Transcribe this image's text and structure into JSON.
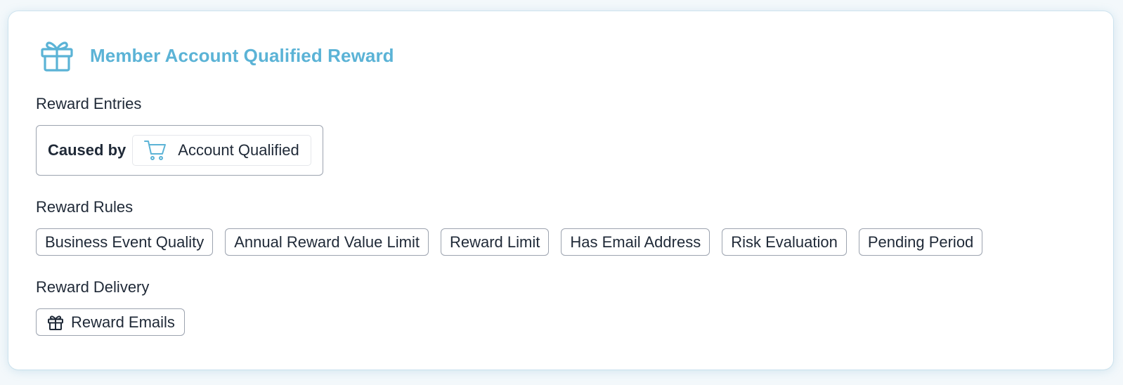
{
  "card": {
    "title": "Member Account Qualified Reward",
    "icon": "gift-icon",
    "accent_color": "#5bb3d6"
  },
  "entries": {
    "label": "Reward Entries",
    "caused_by": "Caused by",
    "event": {
      "icon": "cart-icon",
      "label": "Account Qualified"
    }
  },
  "rules": {
    "label": "Reward Rules",
    "items": [
      "Business Event Quality",
      "Annual Reward Value Limit",
      "Reward Limit",
      "Has Email Address",
      "Risk Evaluation",
      "Pending Period"
    ]
  },
  "delivery": {
    "label": "Reward Delivery",
    "items": [
      {
        "icon": "gift-icon",
        "label": "Reward Emails"
      }
    ]
  }
}
